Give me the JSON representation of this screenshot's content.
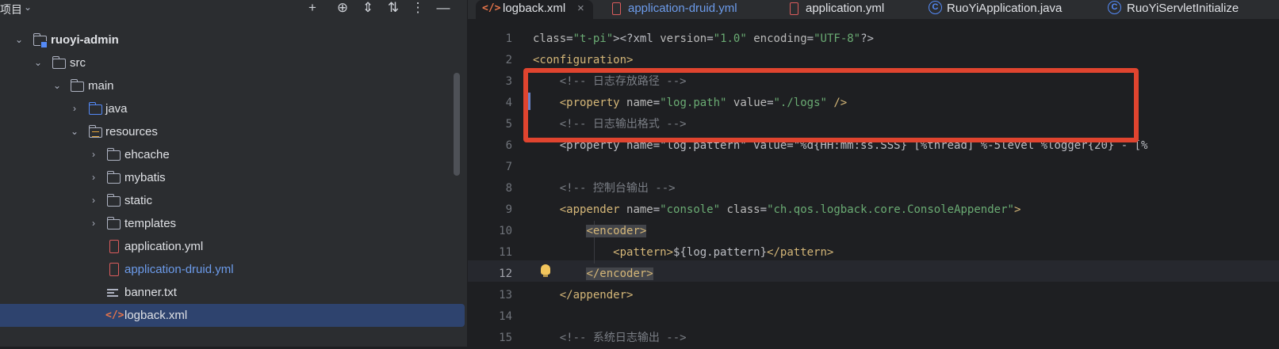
{
  "project_panel": {
    "title": "项目",
    "tree": [
      {
        "label": "ruoyi-admin",
        "type": "module",
        "expanded": true
      },
      {
        "label": "src",
        "type": "folder",
        "expanded": true
      },
      {
        "label": "main",
        "type": "folder",
        "expanded": true
      },
      {
        "label": "java",
        "type": "source-folder",
        "expanded": false
      },
      {
        "label": "resources",
        "type": "resources-folder",
        "expanded": true
      },
      {
        "label": "ehcache",
        "type": "folder",
        "expanded": false
      },
      {
        "label": "mybatis",
        "type": "folder",
        "expanded": false
      },
      {
        "label": "static",
        "type": "folder",
        "expanded": false
      },
      {
        "label": "templates",
        "type": "folder",
        "expanded": false
      },
      {
        "label": "application.yml",
        "type": "yml-file"
      },
      {
        "label": "application-druid.yml",
        "type": "yml-file",
        "modified": true
      },
      {
        "label": "banner.txt",
        "type": "text-file"
      },
      {
        "label": "logback.xml",
        "type": "xml-file",
        "selected": true
      }
    ]
  },
  "tabs": [
    {
      "label": "logback.xml",
      "icon": "xml-icon",
      "active": true,
      "close": "×"
    },
    {
      "label": "application-druid.yml",
      "icon": "yml-icon",
      "modified": true
    },
    {
      "label": "application.yml",
      "icon": "yml-icon"
    },
    {
      "label": "RuoYiApplication.java",
      "icon": "class-icon"
    },
    {
      "label": "RuoYiServletInitialize",
      "icon": "class-icon"
    }
  ],
  "editor": {
    "line_numbers": [
      "1",
      "2",
      "3",
      "4",
      "5",
      "6",
      "7",
      "8",
      "9",
      "10",
      "11",
      "12",
      "13",
      "14",
      "15"
    ],
    "current_line": "12",
    "lines": [
      "<?xml version=\"1.0\" encoding=\"UTF-8\"?>",
      "<configuration>",
      "    <!-- 日志存放路径 -->",
      "    <property name=\"log.path\" value=\"./logs\" />",
      "    <!-- 日志输出格式 -->",
      "    <property name=\"log.pattern\" value=\"%d{HH:mm:ss.SSS} [%thread] %-5level %logger{20} - [%",
      "",
      "    <!-- 控制台输出 -->",
      "    <appender name=\"console\" class=\"ch.qos.logback.core.ConsoleAppender\">",
      "        <encoder>",
      "            <pattern>${log.pattern}</pattern>",
      "        </encoder>",
      "    </appender>",
      "",
      "    <!-- 系统日志输出 -->"
    ]
  },
  "colors": {
    "accent_selection": "#2e436e",
    "highlight_box": "#e0442f",
    "xml_tag": "#d5b778",
    "xml_value": "#6aab73",
    "comment": "#7a7e85"
  }
}
